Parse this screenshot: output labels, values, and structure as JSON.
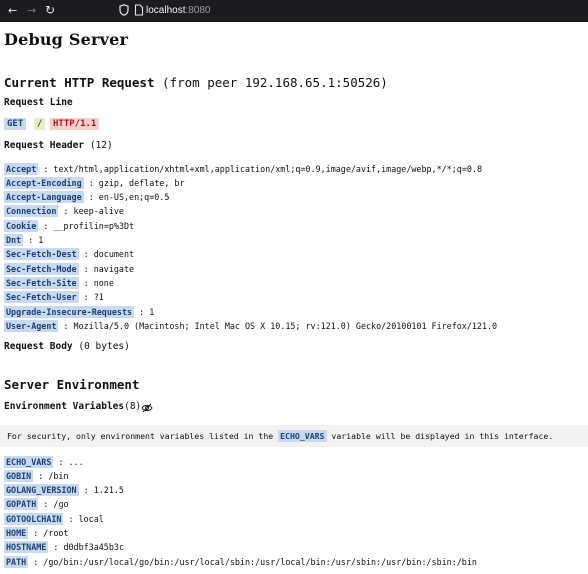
{
  "browser": {
    "back_icon": "arrow-left-icon",
    "forward_icon": "arrow-right-icon",
    "reload_icon": "reload-icon",
    "shield_icon": "shield-icon",
    "page_icon": "page-icon",
    "url_host": "localhost",
    "url_port": ":8080"
  },
  "page": {
    "title": "Debug Server"
  },
  "request": {
    "heading": "Current HTTP Request",
    "peer": "(from peer 192.168.65.1:50526)",
    "line_heading": "Request Line",
    "method": "GET",
    "path": "/",
    "protocol": "HTTP/1.1",
    "header_heading": "Request Header",
    "header_count": "(12)",
    "headers": [
      {
        "key": "Accept",
        "value": ": text/html,application/xhtml+xml,application/xml;q=0.9,image/avif,image/webp,*/*;q=0.8"
      },
      {
        "key": "Accept-Encoding",
        "value": ": gzip, deflate, br"
      },
      {
        "key": "Accept-Language",
        "value": ": en-US,en;q=0.5"
      },
      {
        "key": "Connection",
        "value": ": keep-alive"
      },
      {
        "key": "Cookie",
        "value": ": __profilin=p%3Dt"
      },
      {
        "key": "Dnt",
        "value": ": 1"
      },
      {
        "key": "Sec-Fetch-Dest",
        "value": ": document"
      },
      {
        "key": "Sec-Fetch-Mode",
        "value": ": navigate"
      },
      {
        "key": "Sec-Fetch-Site",
        "value": ": none"
      },
      {
        "key": "Sec-Fetch-User",
        "value": ": ?1"
      },
      {
        "key": "Upgrade-Insecure-Requests",
        "value": ": 1"
      },
      {
        "key": "User-Agent",
        "value": ": Mozilla/5.0 (Macintosh; Intel Mac OS X 10.15; rv:121.0) Gecko/20100101 Firefox/121.0"
      }
    ],
    "body_heading": "Request Body",
    "body_size": "(0 bytes)"
  },
  "environment": {
    "heading": "Server Environment",
    "vars_heading": "Environment Variables",
    "vars_count": "(8)",
    "hidden_icon": "eye-off-icon",
    "notice_before": "For security, only environment variables listed in the ",
    "notice_keyword": "ECHO_VARS",
    "notice_after": " variable will be displayed in this interface.",
    "vars": [
      {
        "key": "ECHO_VARS",
        "value": ": ..."
      },
      {
        "key": "GOBIN",
        "value": ": /bin"
      },
      {
        "key": "GOLANG_VERSION",
        "value": ": 1.21.5"
      },
      {
        "key": "GOPATH",
        "value": ": /go"
      },
      {
        "key": "GOTOOLCHAIN",
        "value": ": local"
      },
      {
        "key": "HOME",
        "value": ": /root"
      },
      {
        "key": "HOSTNAME",
        "value": ": d0dbf3a45b3c"
      },
      {
        "key": "PATH",
        "value": ": /go/bin:/usr/local/go/bin:/usr/local/sbin:/usr/local/bin:/usr/sbin:/usr/bin:/sbin:/bin"
      }
    ]
  }
}
